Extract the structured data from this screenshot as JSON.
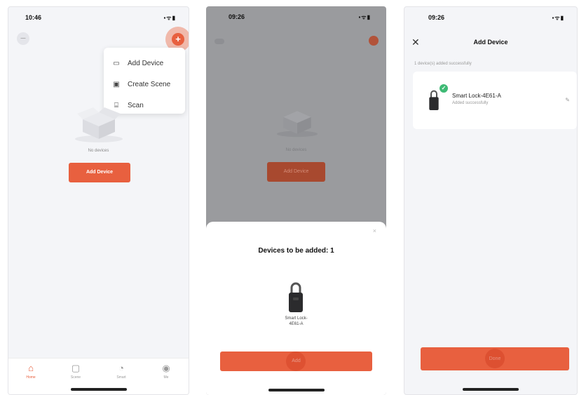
{
  "screen1": {
    "status_time": "10:46",
    "status_icons": "▪ᯤ▮",
    "avatar_text": "—",
    "plus_label": "+",
    "menu": [
      {
        "icon": "▭",
        "label": "Add Device"
      },
      {
        "icon": "▣",
        "label": "Create Scene"
      },
      {
        "icon": "⌸",
        "label": "Scan"
      }
    ],
    "empty_label": "No devices",
    "add_device_label": "Add Device",
    "tabs": [
      {
        "icon": "⌂",
        "label": "Home"
      },
      {
        "icon": "▢",
        "label": "Scene"
      },
      {
        "icon": "◔",
        "label": "Smart"
      },
      {
        "icon": "◉",
        "label": "Me"
      }
    ]
  },
  "screen2": {
    "status_time": "09:26",
    "status_icons": "▪ᯤ▮",
    "ghost_empty_label": "No devices",
    "ghost_add_label": "Add Device",
    "close_label": "×",
    "sheet_title": "Devices to be added: 1",
    "device_name_line1": "Smart Lock-",
    "device_name_line2": "4E61-A",
    "add_label": "Add"
  },
  "screen3": {
    "status_time": "09:26",
    "status_icons": "▪ᯤ▮",
    "close_label": "✕",
    "title": "Add Device",
    "success_note": "1 device(s) added successfully",
    "check_label": "✓",
    "device_name": "Smart Lock-4E61-A",
    "device_status": "Added successfully",
    "edit_label": "✎",
    "done_label": "Done"
  },
  "colors": {
    "accent": "#e8603f",
    "success": "#3fba75"
  }
}
